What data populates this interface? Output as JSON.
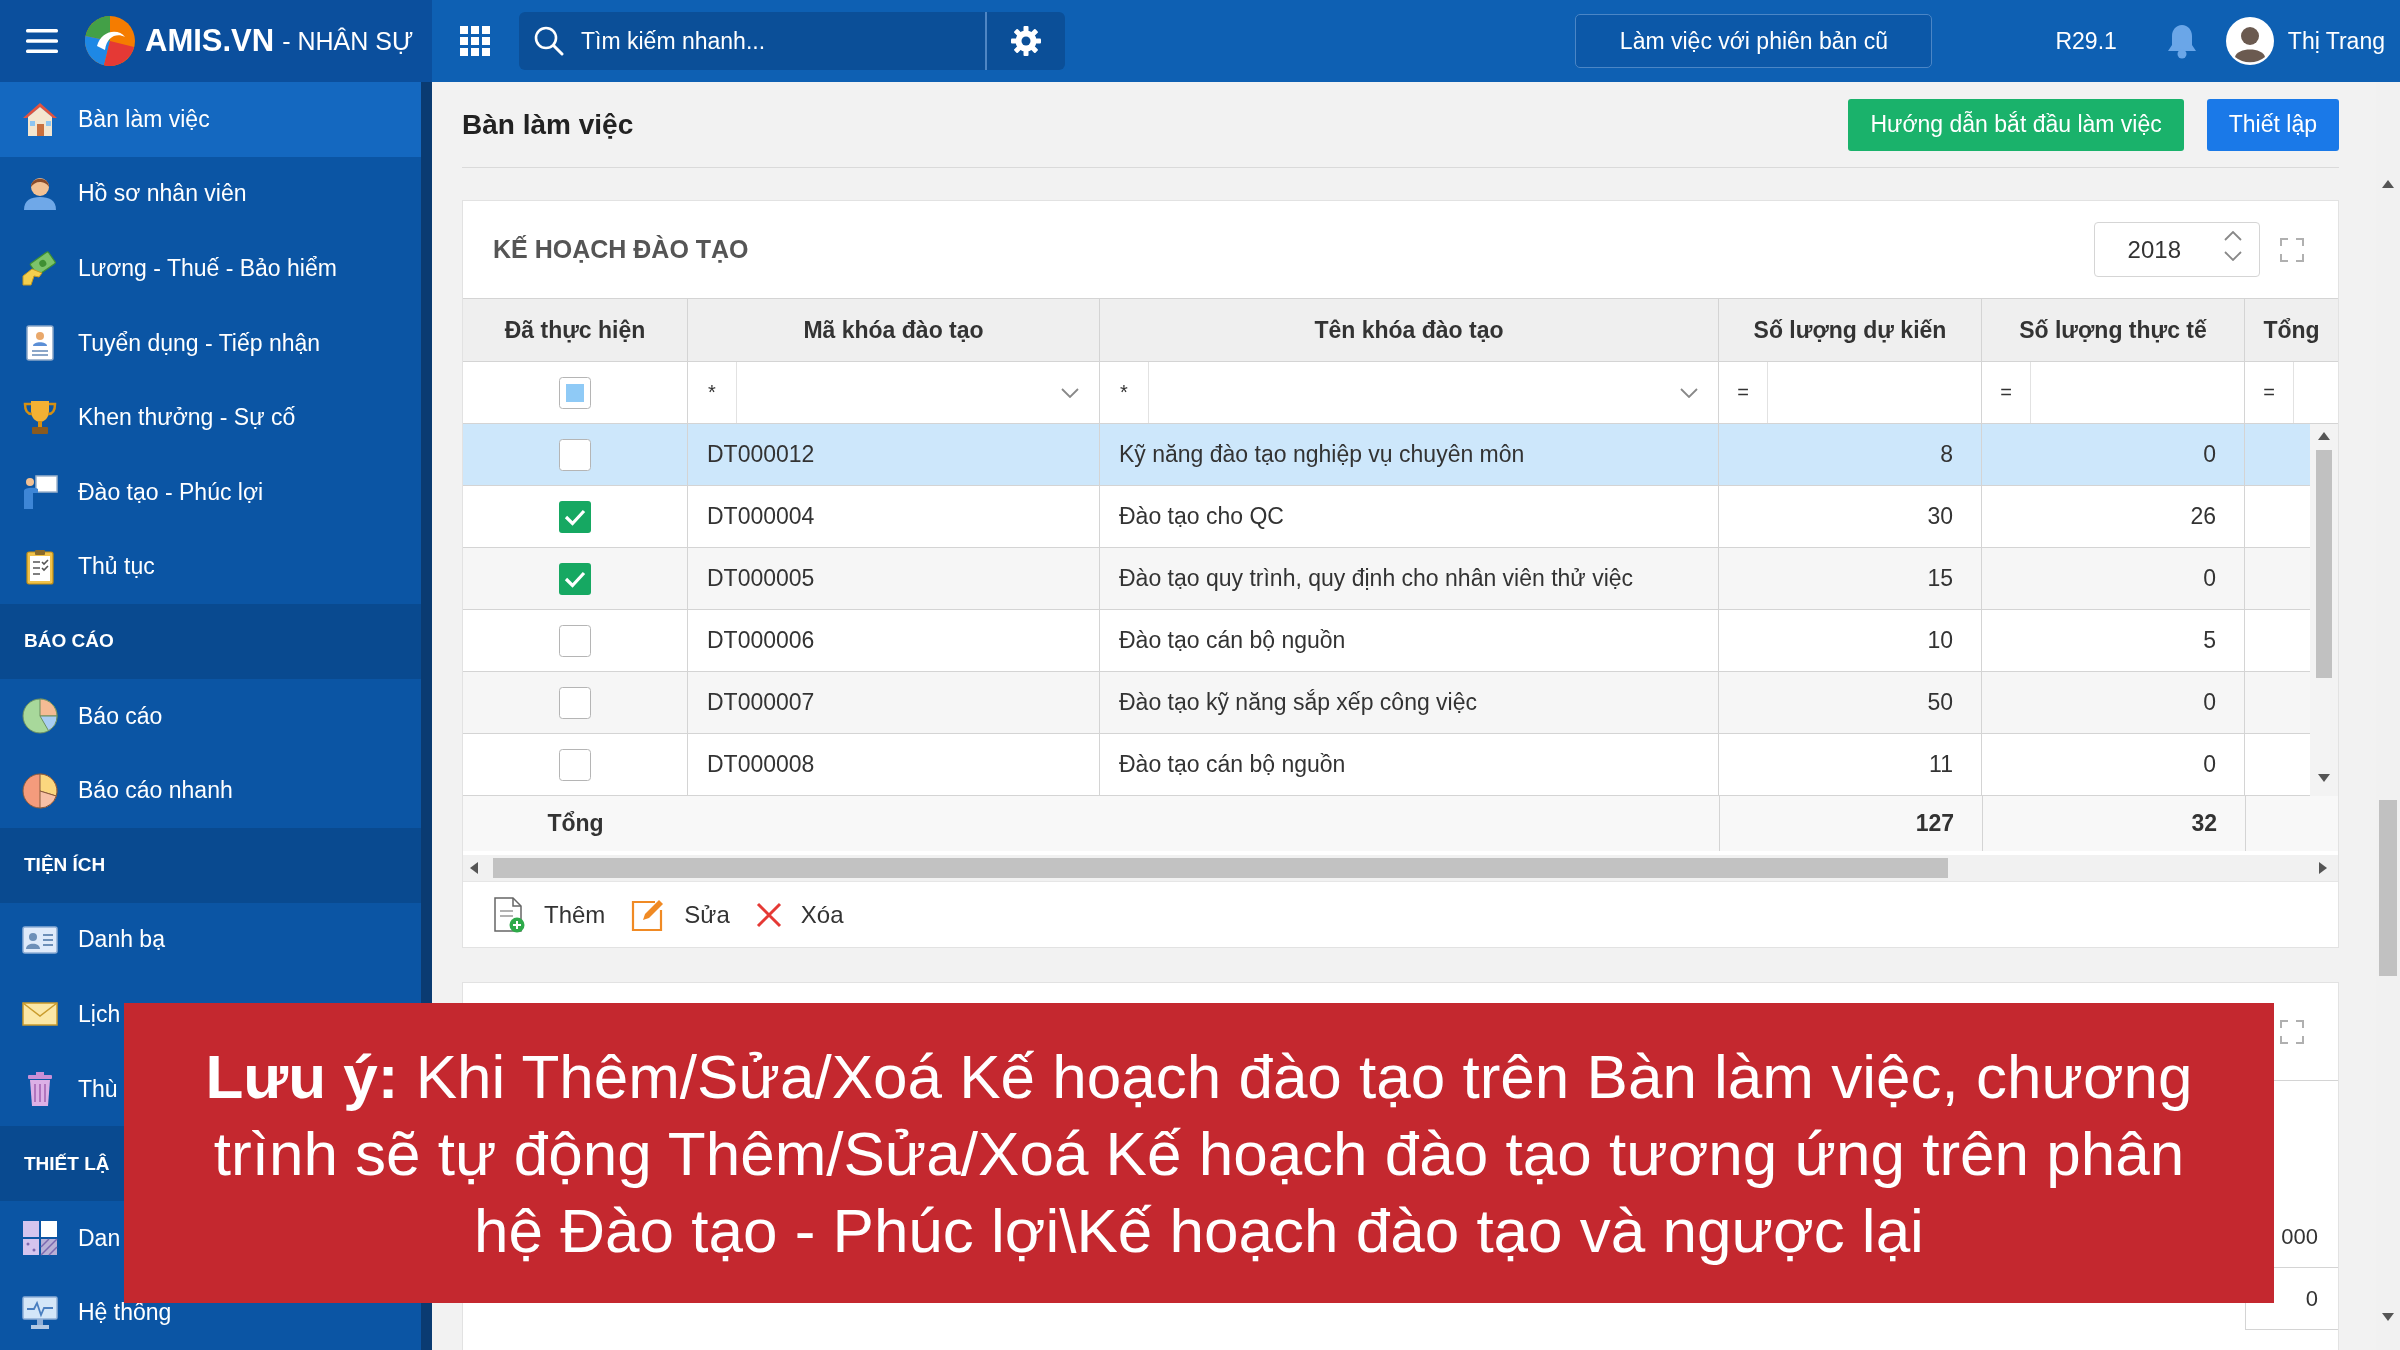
{
  "top_bar": {
    "brand": "AMIS.VN",
    "module": "- NHÂN SỰ",
    "search": {
      "placeholder": "Tìm kiếm nhanh..."
    },
    "legacy_button": "Làm việc với phiên bản cũ",
    "version": "R29.1",
    "user_name": "Thị Trang"
  },
  "sidebar": {
    "sections": [
      {
        "items": [
          {
            "label": "Bàn làm việc",
            "selected": true
          },
          {
            "label": "Hồ sơ nhân viên",
            "selected": false
          },
          {
            "label": "Lương - Thuế - Bảo hiểm",
            "selected": false
          },
          {
            "label": "Tuyển dụng - Tiếp nhận",
            "selected": false
          },
          {
            "label": "Khen thưởng - Sự cố",
            "selected": false
          },
          {
            "label": "Đào tạo - Phúc lợi",
            "selected": false
          },
          {
            "label": "Thủ tục",
            "selected": false
          }
        ]
      },
      {
        "title": "BÁO CÁO",
        "items": [
          {
            "label": "Báo cáo",
            "selected": false
          },
          {
            "label": "Báo cáo nhanh",
            "selected": false
          }
        ]
      },
      {
        "title": "TIỆN ÍCH",
        "items": [
          {
            "label": "Danh bạ",
            "selected": false
          },
          {
            "label": "Lịch",
            "selected": false
          },
          {
            "label": "Thù",
            "selected": false
          }
        ]
      },
      {
        "title": "THIẾT LẬ",
        "items": [
          {
            "label": "Dan",
            "selected": false
          },
          {
            "label": "Hệ thống",
            "selected": false
          }
        ]
      }
    ]
  },
  "page": {
    "title": "Bàn làm việc",
    "buttons": [
      {
        "label": "Hướng dẫn bắt đầu làm việc",
        "kind": "success"
      },
      {
        "label": "Thiết lập",
        "kind": "primary"
      }
    ]
  },
  "training_plan": {
    "title": "KẾ HOẠCH ĐÀO TẠO",
    "year": "2018",
    "table": {
      "columns": [
        "Đã thực hiện",
        "Mã khóa đào tạo",
        "Tên khóa đào tạo",
        "Số lượng dự kiến",
        "Số lượng thực tế",
        "Tổng"
      ],
      "filters": [
        {
          "kind": "checkbox",
          "indeterminate": true
        },
        {
          "kind": "select",
          "operator": "*"
        },
        {
          "kind": "select",
          "operator": "*"
        },
        {
          "kind": "number",
          "operator": "="
        },
        {
          "kind": "number",
          "operator": "="
        },
        {
          "kind": "number",
          "operator": "="
        }
      ],
      "rows": [
        {
          "selected": true,
          "done": false,
          "code": "DT000012",
          "name": "Kỹ năng đào tạo nghiệp vụ chuyên môn",
          "planned": "8",
          "actual": "0"
        },
        {
          "selected": false,
          "done": true,
          "code": "DT000004",
          "name": "Đào tạo cho QC",
          "planned": "30",
          "actual": "26"
        },
        {
          "selected": false,
          "done": true,
          "code": "DT000005",
          "name": "Đào tạo quy trình, quy định cho nhân viên thử việc",
          "planned": "15",
          "actual": "0"
        },
        {
          "selected": false,
          "done": false,
          "code": "DT000006",
          "name": "Đào tạo cán bộ nguồn",
          "planned": "10",
          "actual": "5"
        },
        {
          "selected": false,
          "done": false,
          "code": "DT000007",
          "name": "Đào tạo kỹ năng sắp xếp công việc",
          "planned": "50",
          "actual": "0"
        },
        {
          "selected": false,
          "done": false,
          "code": "DT000008",
          "name": "Đào tạo cán bộ nguồn",
          "planned": "11",
          "actual": "0"
        }
      ],
      "totals": {
        "label": "Tổng",
        "planned": "127",
        "actual": "32"
      }
    },
    "actions": [
      {
        "label": "Thêm",
        "kind": "add"
      },
      {
        "label": "Sửa",
        "kind": "edit"
      },
      {
        "label": "Xóa",
        "kind": "delete"
      }
    ]
  },
  "reward_plan": {
    "rows": [
      {
        "column_6": "000"
      },
      {
        "column_6": "0"
      }
    ]
  },
  "notice": {
    "text": "**Lưu ý:** Khi Thêm/Sửa/Xoá Kế hoạch đào tạo trên Bàn làm việc, chương\ntrình sẽ tự động Thêm/Sửa/Xoá Kế hoạch đào tạo tương ứng trên phân\nhệ Đào tạo - Phúc lợi\\Kế hoạch đào tạo và ngược lại"
  }
}
